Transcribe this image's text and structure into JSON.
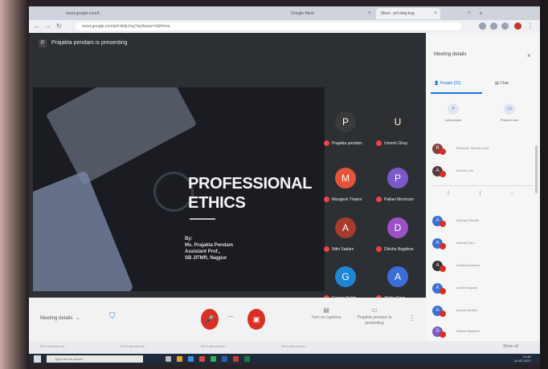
{
  "browser": {
    "tabs": [
      {
        "label": "meet.google.com/f...",
        "active": false
      },
      {
        "label": "Google Meet",
        "active": false
      },
      {
        "label": "Meet - prf-dekj-kxg",
        "active": true
      },
      {
        "label": "",
        "active": false
      }
    ],
    "url": "meet.google.com/prf-dekj-kxg?authuser=1&hl=en"
  },
  "stage": {
    "presenter_initial": "P",
    "presenting_text": "Prajakta pendam is presenting"
  },
  "slide": {
    "title_line1": "PROFESSIONAL",
    "title_line2": "ETHICS",
    "by_line1": "By:",
    "by_line2": "Ms. Prajakta Pendam",
    "by_line3": "Assistant Prof.,",
    "by_line4": "SB JITMR, Nagpur"
  },
  "tiles": [
    {
      "initial": "P",
      "name": "Prajakta pendam",
      "color": "#3b3b3b"
    },
    {
      "initial": "U",
      "name": "Umesh Ghuy",
      "color": "#2f2f2f"
    },
    {
      "initial": "M",
      "name": "Mangesh Thakre",
      "color": "#e55338"
    },
    {
      "initial": "P",
      "name": "Pallavi Meshram",
      "color": "#7b59c9"
    },
    {
      "initial": "A",
      "name": "Nitin Sadam",
      "color": "#a63b2e"
    },
    {
      "initial": "D",
      "name": "Diksha Nagdeve",
      "color": "#9c52c6"
    },
    {
      "initial": "G",
      "name": "Gunjan Nakhi",
      "color": "#1f86d6"
    },
    {
      "initial": "A",
      "name": "Alisha Raut",
      "color": "#3a6fd6"
    }
  ],
  "bottombar": {
    "meeting_details": "Meeting details",
    "turn_on_captions": "Turn on captions",
    "presenting_label": "Prajakta pendam is presenting"
  },
  "panel": {
    "title": "Meeting details",
    "people_tab": "People (32)",
    "chat_tab": "Chat",
    "add_people": "Add people",
    "present_now": "Present now",
    "people": [
      {
        "initial": "R",
        "name": "Rushabh Tekade (You)",
        "color": "#8a3b3b"
      },
      {
        "initial": "A",
        "name": "Ashish Lohi",
        "color": "#5a3a3a"
      },
      {
        "initial": "A",
        "name": "Akshay Dhande",
        "color": "#3a6fd6"
      },
      {
        "initial": "A",
        "name": "Akshay Raut",
        "color": "#3a6fd6"
      },
      {
        "initial": "A",
        "name": "Ankita Meshram",
        "color": "#333"
      },
      {
        "initial": "A",
        "name": "Ankita Nagrale",
        "color": "#3a6fd6"
      },
      {
        "initial": "A",
        "name": "Ayushi Akolkar",
        "color": "#3a6fd6"
      },
      {
        "initial": "D",
        "name": "Diksha Nagdeve",
        "color": "#7b59c9"
      }
    ]
  },
  "shelf": {
    "items": [
      "Meet attendance...",
      "Meet attendance...",
      "Meet attendance...",
      "Meet attendance..."
    ],
    "show_all": "Show all"
  },
  "taskbar": {
    "search_placeholder": "Type here to search",
    "time": "10:45",
    "date": "24-03-2021"
  },
  "colors": {
    "accent": "#1a73e8",
    "end_call": "#d93025"
  }
}
